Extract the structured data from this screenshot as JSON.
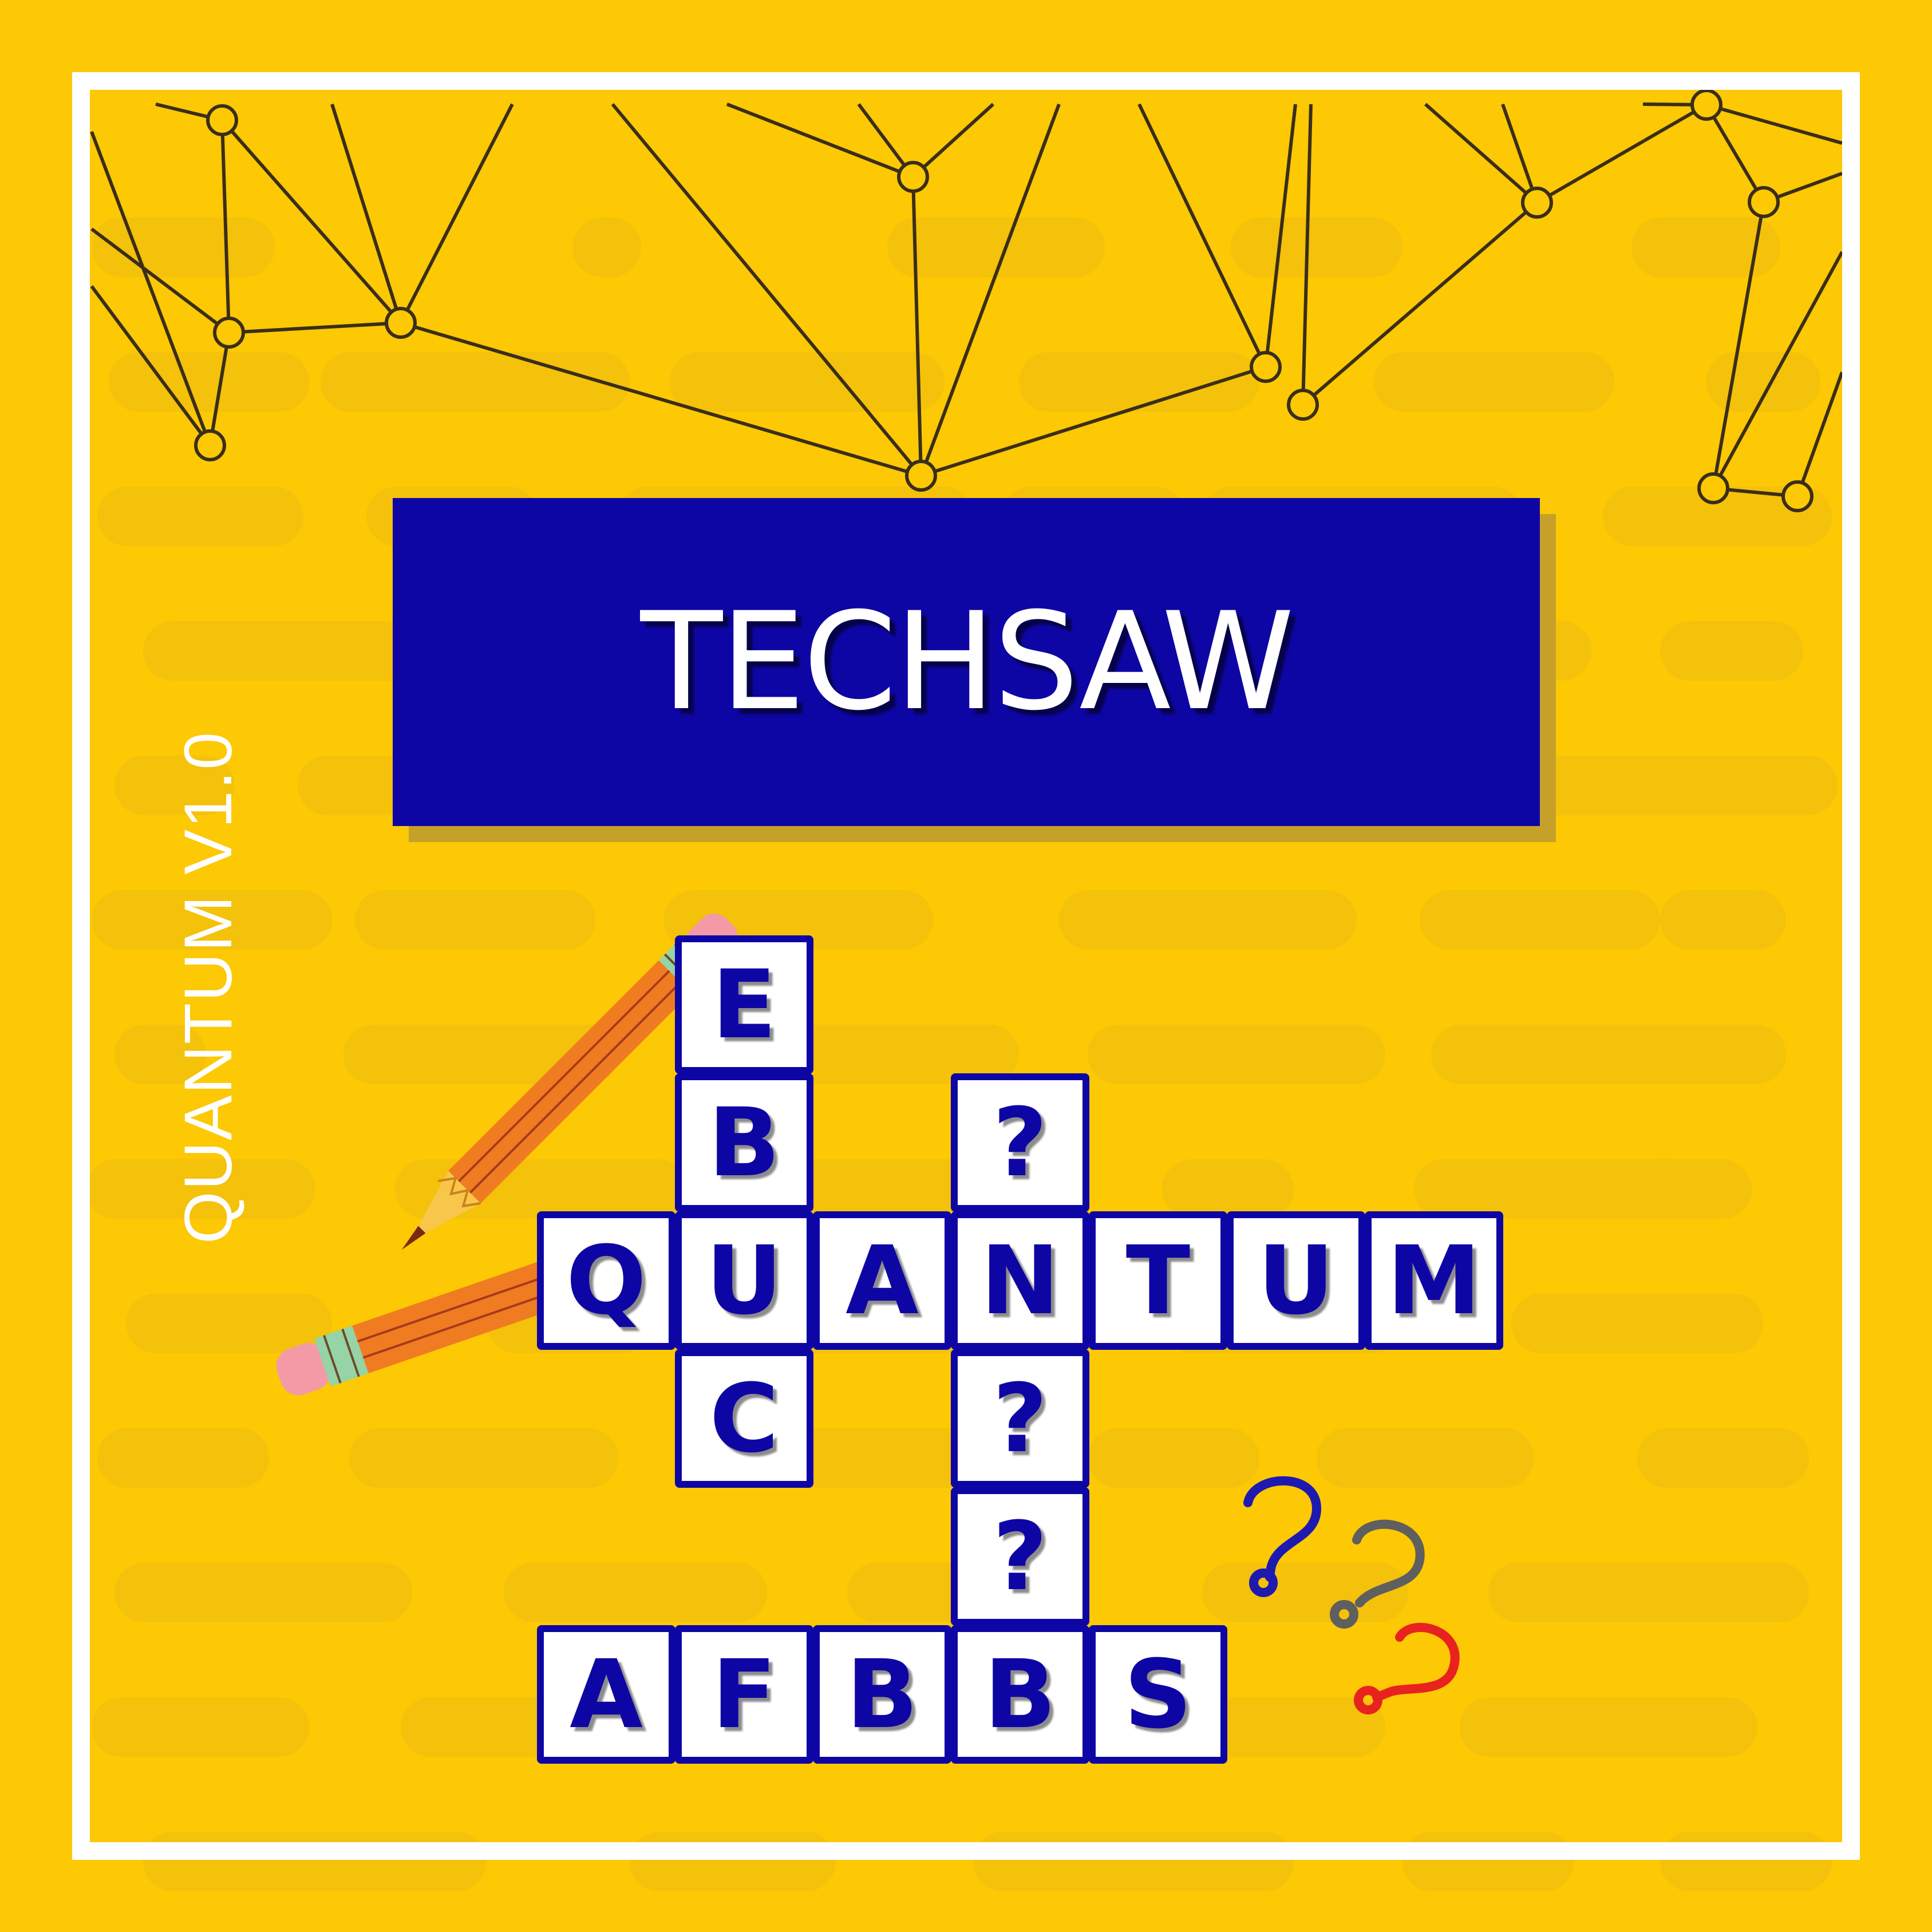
{
  "poster": {
    "title": "TECHSAW",
    "side_label": "QUANTUM V1.0"
  },
  "colors": {
    "background": "#fdc804",
    "frame": "#ffffff",
    "banner": "#0e06a4",
    "banner_shadow": "#c6a12a",
    "cell_border": "#0e06a4",
    "cell_text": "#0e06a4",
    "network_line": "#3a2e1a",
    "pencil_body": "#f07c22",
    "qmark_colors": [
      "#1e1ab0",
      "#5f5f5f",
      "#e8231f"
    ]
  },
  "crossword": {
    "cells": [
      {
        "id": "v1-1",
        "letter": "E"
      },
      {
        "id": "v1-2",
        "letter": "B"
      },
      {
        "id": "h1-1",
        "letter": "Q"
      },
      {
        "id": "h1-2",
        "letter": "U"
      },
      {
        "id": "h1-3",
        "letter": "A"
      },
      {
        "id": "h1-4",
        "letter": "N"
      },
      {
        "id": "h1-5",
        "letter": "T"
      },
      {
        "id": "h1-6",
        "letter": "U"
      },
      {
        "id": "h1-7",
        "letter": "M"
      },
      {
        "id": "v1-4",
        "letter": "C"
      },
      {
        "id": "v2-1",
        "letter": "?"
      },
      {
        "id": "v2-3",
        "letter": "?"
      },
      {
        "id": "v2-4",
        "letter": "?"
      },
      {
        "id": "h2-1",
        "letter": "A"
      },
      {
        "id": "h2-2",
        "letter": "F"
      },
      {
        "id": "h2-3",
        "letter": "B"
      },
      {
        "id": "h2-4",
        "letter": "B"
      },
      {
        "id": "h2-5",
        "letter": "S"
      }
    ]
  },
  "decorations": {
    "pencil_icons": [
      "pencil-icon",
      "pencil-icon"
    ],
    "question_mark_icons": [
      "question-mark-icon",
      "question-mark-icon",
      "question-mark-icon"
    ],
    "network_icon": "network-graph-icon"
  }
}
